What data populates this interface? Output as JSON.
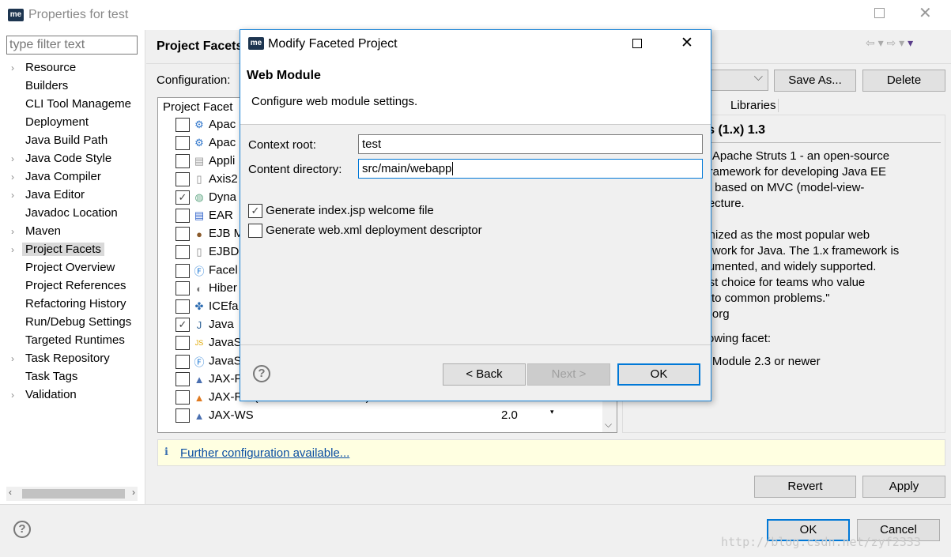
{
  "window": {
    "title": "Properties for test",
    "logo": "me"
  },
  "sidebar": {
    "filter_placeholder": "type filter text",
    "items": [
      {
        "label": "Resource",
        "chevron": true
      },
      {
        "label": "Builders",
        "chevron": false
      },
      {
        "label": "CLI Tool Manageme",
        "chevron": false
      },
      {
        "label": "Deployment",
        "chevron": false
      },
      {
        "label": "Java Build Path",
        "chevron": false
      },
      {
        "label": "Java Code Style",
        "chevron": true
      },
      {
        "label": "Java Compiler",
        "chevron": true
      },
      {
        "label": "Java Editor",
        "chevron": true
      },
      {
        "label": "Javadoc Location",
        "chevron": false
      },
      {
        "label": "Maven",
        "chevron": true
      },
      {
        "label": "Project Facets",
        "chevron": true,
        "selected": true
      },
      {
        "label": "Project Overview",
        "chevron": false
      },
      {
        "label": "Project References",
        "chevron": false
      },
      {
        "label": "Refactoring History",
        "chevron": false
      },
      {
        "label": "Run/Debug Settings",
        "chevron": false
      },
      {
        "label": "Targeted Runtimes",
        "chevron": false
      },
      {
        "label": "Task Repository",
        "chevron": true
      },
      {
        "label": "Task Tags",
        "chevron": false
      },
      {
        "label": "Validation",
        "chevron": true
      }
    ]
  },
  "main": {
    "title": "Project Facets",
    "configuration_label": "Configuration:",
    "save_as": "Save As...",
    "delete": "Delete",
    "facet_header": "Project Facet",
    "tabs": [
      "es",
      "Libraries"
    ],
    "facets": [
      {
        "name": "Apac",
        "checked": false,
        "icon": "gear-icon",
        "version": ""
      },
      {
        "name": "Apac",
        "checked": false,
        "icon": "gear-icon",
        "version": ""
      },
      {
        "name": "Appli",
        "checked": false,
        "icon": "jar-icon",
        "version": ""
      },
      {
        "name": "Axis2",
        "checked": false,
        "icon": "document-icon",
        "version": ""
      },
      {
        "name": "Dyna",
        "checked": true,
        "icon": "web-jar-icon",
        "version": ""
      },
      {
        "name": "EAR",
        "checked": false,
        "icon": "ear-icon",
        "version": ""
      },
      {
        "name": "EJB M",
        "checked": false,
        "icon": "bean-icon",
        "version": ""
      },
      {
        "name": "EJBDc",
        "checked": false,
        "icon": "document-icon",
        "version": ""
      },
      {
        "name": "Facel",
        "checked": false,
        "icon": "f-icon",
        "version": ""
      },
      {
        "name": "Hiber",
        "checked": false,
        "icon": "hibernate-icon",
        "version": ""
      },
      {
        "name": "ICEfa",
        "checked": false,
        "icon": "icefaces-icon",
        "version": ""
      },
      {
        "name": "Java",
        "checked": true,
        "icon": "java-icon",
        "version": ""
      },
      {
        "name": "JavaS",
        "checked": false,
        "icon": "js-icon",
        "version": ""
      },
      {
        "name": "JavaS",
        "checked": false,
        "icon": "f-icon",
        "version": ""
      },
      {
        "name": "JAX-F",
        "checked": false,
        "icon": "flask-icon",
        "version": ""
      },
      {
        "name": "JAX-RS (REST Web Services)",
        "checked": false,
        "icon": "flask-orange-icon",
        "version": "1.1"
      },
      {
        "name": "JAX-WS",
        "checked": false,
        "icon": "flask-icon",
        "version": "2.0"
      }
    ],
    "details": {
      "title": "uts (1.x) 1.3",
      "lines": [
        "for Apache Struts 1 - an open-source",
        "n framework for developing Java EE",
        "ns, based on MVC (model-view-",
        "nitecture.",
        "",
        "ognized as the most popular web",
        "mework for Java. The 1.x framework is",
        "ocumented, and widely supported.",
        "best choice for teams who value",
        "ns to common problems.\"",
        "ne.org"
      ],
      "requires": "ollowing facet:",
      "requirement": "eb Module 2.3 or newer"
    },
    "info": "Further configuration available...",
    "revert": "Revert",
    "apply": "Apply"
  },
  "footer": {
    "ok": "OK",
    "cancel": "Cancel",
    "watermark": "http://blog.csdn.net/zyf2333"
  },
  "dialog": {
    "title": "Modify Faceted Project",
    "heading": "Web Module",
    "subtitle": "Configure web module settings.",
    "context_root_label": "Context root:",
    "context_root": "test",
    "content_dir_label": "Content directory:",
    "content_dir": "src/main/webapp",
    "gen_index": {
      "label": "Generate index.jsp welcome file",
      "checked": true
    },
    "gen_webxml": {
      "label": "Generate web.xml deployment descriptor",
      "checked": false
    },
    "back": "< Back",
    "next": "Next >",
    "ok": "OK"
  }
}
